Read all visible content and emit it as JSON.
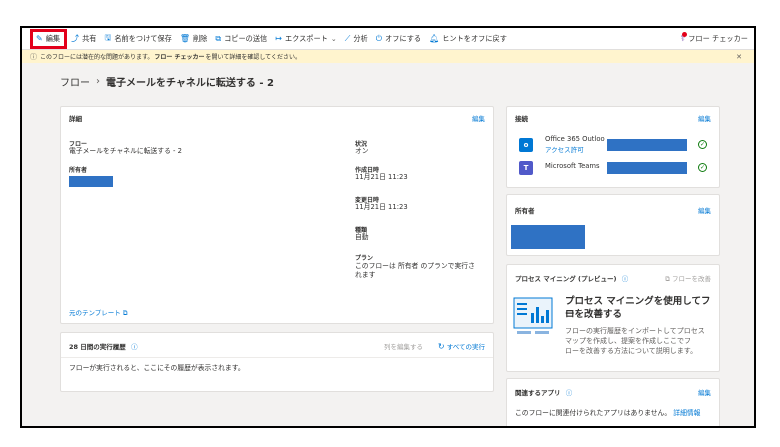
{
  "toolbar": {
    "edit": "編集",
    "share": "共有",
    "save_as": "名前をつけて保存",
    "delete": "削除",
    "send_copy": "コピーの送信",
    "export": "エクスポート",
    "analytics": "分析",
    "turn_off": "オフにする",
    "hints_off": "ヒントをオフに戻す",
    "flow_checker": "フロー チェッカー"
  },
  "message_bar": {
    "text_before": "このフローには潜在的な問題があります。",
    "text_bold": "フロー チェッカー",
    "text_after": "を開いて詳細を確認してください。"
  },
  "breadcrumb": {
    "root": "フロー",
    "current": "電子メールをチャネルに転送する - 2"
  },
  "details": {
    "title": "詳細",
    "edit": "編集",
    "flow_label": "フロー",
    "flow_value": "電子メールをチャネルに転送する - 2",
    "owner_label": "所有者",
    "status_label": "状況",
    "status_value": "オン",
    "created_label": "作成日時",
    "created_value": "11月21日 11:23",
    "modified_label": "変更日時",
    "modified_value": "11月21日 11:23",
    "type_label": "種類",
    "type_value": "自動",
    "plan_label": "プラン",
    "plan_value_line1": "このフローは 所有者 のプランで実行さ",
    "plan_value_line2": "れます",
    "template_link": "元のテンプレート"
  },
  "history": {
    "title": "28 日間の実行履歴",
    "edit_columns": "列を編集する",
    "all_runs": "すべての実行",
    "empty": "フローが実行されると、ここにその履歴が表示されます。"
  },
  "connections": {
    "title": "接続",
    "edit": "編集",
    "items": [
      {
        "name": "Office 365 Outloo",
        "sub": "アクセス許可",
        "color": "#0078d4"
      },
      {
        "name": "Microsoft Teams",
        "sub": "",
        "color": "#5059c9"
      }
    ]
  },
  "owners": {
    "title": "所有者",
    "edit": "編集"
  },
  "process_mining": {
    "title": "プロセス マイニング (プレビュー)",
    "improve_link": "フローを改善",
    "heading_line1": "プロセス マイニングを使用してフロ",
    "heading_line2": "ーを改善する",
    "desc_line1": "フローの実行履歴をインポートしてプロセス",
    "desc_line2": "マップを作成し、提案を作成しここでフ",
    "desc_line3": "ローを改善する方法について説明します。"
  },
  "related_apps": {
    "title": "関連するアプリ",
    "edit": "編集",
    "text": "このフローに関連付けられたアプリはありません。",
    "link": "詳細情報"
  }
}
